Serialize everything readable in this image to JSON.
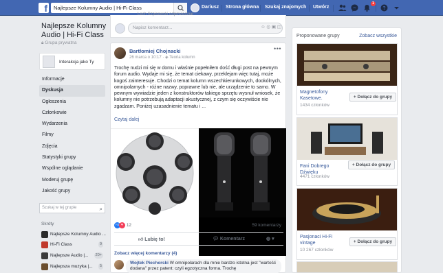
{
  "topbar": {
    "search_value": "Najlepsze Kolumny Audio | Hi-Fi Class",
    "user_name": "Dariusz",
    "home_label": "Strona główna",
    "find_friends_label": "Szukaj znajomych",
    "create_label": "Utwórz",
    "notification_count": "1"
  },
  "sidebar": {
    "group_title": "Najlepsze Kolumny Audio | Hi-Fi Class",
    "privacy": "Grupa prywatna",
    "interact_as": "Interakcja jako Ty",
    "menu": [
      {
        "label": "Informacje"
      },
      {
        "label": "Dyskusja",
        "active": true
      },
      {
        "label": "Ogłoszenia"
      },
      {
        "label": "Członkowie"
      },
      {
        "label": "Wydarzenia"
      },
      {
        "label": "Filmy"
      },
      {
        "label": "Zdjęcia"
      },
      {
        "label": "Statystyki grupy"
      },
      {
        "label": "Wspólne oglądanie"
      },
      {
        "label": "Moderuj grupę"
      },
      {
        "label": "Jakość grupy"
      }
    ],
    "search_placeholder": "Szukaj w tej grupie",
    "shortcuts_label": "Skróty",
    "shortcuts": [
      {
        "name": "Najlepsze Kolumny Audio ...",
        "count": "",
        "color": "#2b2b2b"
      },
      {
        "name": "Hi-Fi Class",
        "count": "9",
        "color": "#c0392b"
      },
      {
        "name": "Najlepsze Audio |...",
        "count": "20+",
        "color": "#3b3b3b"
      },
      {
        "name": "Najlepsza muzyka |...",
        "count": "5",
        "color": "#6b4e2e"
      }
    ]
  },
  "composer": {
    "prev_author": "Lech Szpisewski odpowiedział",
    "placeholder": "Napisz komentarz..."
  },
  "post": {
    "author": "Bartłomiej Chojnacki",
    "date": "26 marca o 10:17",
    "topic": "Teoria kolumn",
    "text": "Trochę nudzi mi się w domu i właśnie popełniłem dość długi post na pewnym forum audio. Wydaje mi się, że temat ciekawy, przeklejam więc tutaj, może kogoś zainteresuje. Chodzi o temat kolumn wszechkierunkowych, dookólnych, omnipolarnych - różne nazwy, poprawne lub nie, ale urządzenie to samo. W pewnym wywiadzie jeden z konstruktorów takiego sprzętu wysnuł wniosek, że kolumny nie potrzebują adaptacji akustycznej, z czym się oczywiście nie zgadzam. Poniżej uzasadnienie tematu i ...",
    "read_more": "Czytaj dalej",
    "reaction_count": "12",
    "comments_count": "59 komentarzy",
    "like_label": "Lubię to!",
    "comment_label": "Komentarz",
    "see_more_comments": "Zobacz więcej komentarzy (4)",
    "comment_author": "Wojtek Piechorski",
    "comment_text": "W omnipolarach dla mnie bardzo istotna jest \"wartość dodana\" przez patent: czyli egzotyczna forma. Trochę"
  },
  "suggestions": {
    "heading": "Proponowane grupy",
    "see_all": "Zobacz wszystkie",
    "join_label": "Dołącz do grupy",
    "groups": [
      {
        "name": "Magnetofony Kasetowe.",
        "members": "1434 członków"
      },
      {
        "name": "Fani Dobrego Dźwięku",
        "members": "4471 członków"
      },
      {
        "name": "Pasjonaci Hi-Fi vintage",
        "members": "10 267 członków"
      }
    ]
  }
}
